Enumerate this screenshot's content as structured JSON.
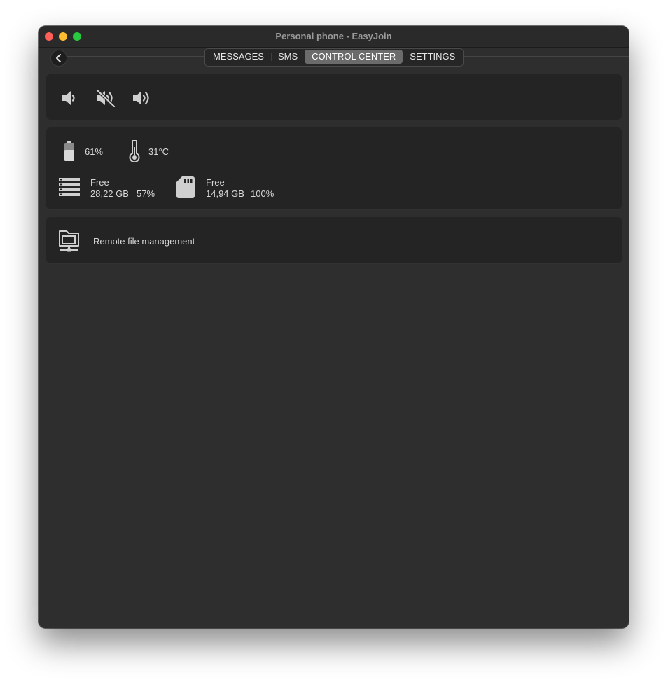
{
  "window": {
    "title": "Personal phone - EasyJoin"
  },
  "nav": {
    "back_icon": "chevron-left-icon",
    "tabs": [
      {
        "label": "MESSAGES",
        "active": false
      },
      {
        "label": "SMS",
        "active": false
      },
      {
        "label": "CONTROL CENTER",
        "active": true
      },
      {
        "label": "SETTINGS",
        "active": false
      }
    ]
  },
  "volume": {
    "buttons": [
      {
        "icon": "volume-down-icon"
      },
      {
        "icon": "volume-mute-icon"
      },
      {
        "icon": "volume-up-icon"
      }
    ]
  },
  "status": {
    "battery": {
      "icon": "battery-icon",
      "value": "61%"
    },
    "temperature": {
      "icon": "thermometer-icon",
      "value": "31°C"
    },
    "internal_storage": {
      "icon": "storage-icon",
      "label": "Free",
      "size": "28,22 GB",
      "percent": "57%"
    },
    "sd_card": {
      "icon": "sd-card-icon",
      "label": "Free",
      "size": "14,94 GB",
      "percent": "100%"
    }
  },
  "files": {
    "icon": "network-folder-icon",
    "label": "Remote file management"
  },
  "colors": {
    "window_bg": "#2e2e2e",
    "card_bg": "#242424",
    "active_tab": "#6b6b6b",
    "icon": "#cfcfcf",
    "close": "#fe5f57",
    "minimize": "#febc2e",
    "zoom": "#28c840"
  }
}
